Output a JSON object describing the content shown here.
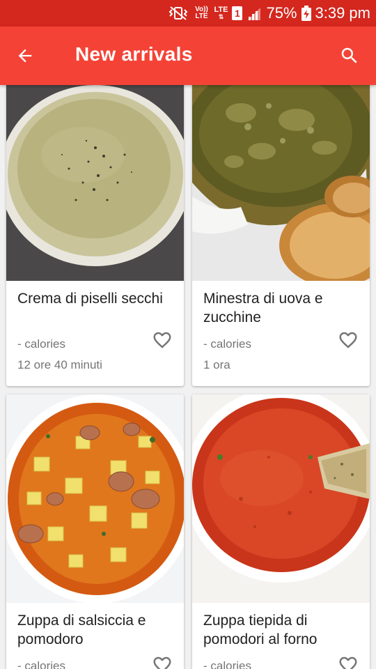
{
  "status": {
    "battery_percent": "75%",
    "time": "3:39 pm",
    "sim_slot": "1",
    "network": "LTE",
    "volte": "Vo)) LTE"
  },
  "appbar": {
    "title": "New arrivals",
    "bg_color": "#f44336"
  },
  "recipes": [
    {
      "name": "Crema di piselli secchi",
      "calories": "- calories",
      "time": "12 ore 40 minuti"
    },
    {
      "name": "Minestra di uova e zucchine",
      "calories": "- calories",
      "time": "1 ora"
    },
    {
      "name": "Zuppa di salsiccia e pomodoro",
      "calories": "- calories",
      "time": ""
    },
    {
      "name": "Zuppa tiepida di pomodori al forno",
      "calories": "- calories",
      "time": ""
    }
  ]
}
